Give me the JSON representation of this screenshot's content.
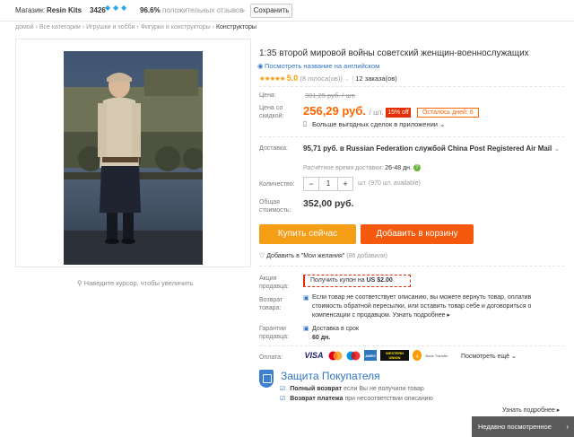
{
  "storebar": {
    "label": "Магазин:",
    "store_name": "Resin Kits",
    "score": "3426",
    "gems": [
      "💎",
      "💎",
      "💎"
    ],
    "positive_pct": "96.6%",
    "positive_label": "положительных отзывов",
    "save_label": "Сохранить"
  },
  "breadcrumb": [
    "домой",
    "Все категории",
    "Игрушки и хобби",
    "Фигурки и конструкторы",
    "Конструкторы"
  ],
  "image": {
    "zoom_hint": "Наведите курсор, чтобы увеличить"
  },
  "product": {
    "title": "1:35 второй мировой войны советский женщин-военнослужащих",
    "translate_link": "Посмотреть название на английском",
    "rating_value": "5.0",
    "votes": "(8 голоса(ов))",
    "orders": "12 заказа(ов)"
  },
  "price": {
    "label": "Цена:",
    "old": "301,25 руб. / шт.",
    "discount_label": "Цена со скидкой:",
    "new": "256,29 руб.",
    "unit": "/ шт.",
    "off_badge": "15% off",
    "days_left": "Осталось дней: 6",
    "app_deal": "Больше выгодных сделок в приложении"
  },
  "shipping": {
    "label": "Доставка:",
    "main": "95,71 руб. в Russian Federation службой China Post Registered Air Mail",
    "est_label": "Расчётное время доставки:",
    "est_value": "26-48 дн."
  },
  "quantity": {
    "label": "Количество:",
    "minus": "−",
    "value": "1",
    "plus": "+",
    "available": "шт. (970 шт. available)"
  },
  "total": {
    "label": "Общая стоимость:",
    "value": "352,00 руб."
  },
  "buttons": {
    "buy": "Купить сейчас",
    "cart": "Добавить в корзину"
  },
  "wishlist": {
    "label": "Добавить в \"Мои желания\"",
    "count": "(86 добавили)"
  },
  "coupon": {
    "label": "Акция продавца:",
    "text": "Получить купон на",
    "amount": "US $2.00"
  },
  "returns": {
    "label": "Возврат товара:",
    "text": "Если товар не соответствует описанию, вы можете вернуть товар, оплатив стоимость обратной пересылки, или оставить товар себе и договориться о компенсации с продавцом.",
    "link": "Узнать подробнее"
  },
  "guarantee": {
    "label": "Гарантии продавца:",
    "text": "Доставка в срок",
    "days": "60 дн."
  },
  "payment": {
    "label": "Оплата:",
    "logos": [
      "VISA",
      "MC",
      "Maestro",
      "AMEX",
      "WESTERN UNION",
      "QIWI",
      "Bank Transfer"
    ],
    "more": "Посмотреть ещё"
  },
  "protection": {
    "title": "Защита Покупателя",
    "line1_bold": "Полный возврат",
    "line1_text": "если Вы не получили товар",
    "line2_bold": "Возврат платежа",
    "line2_text": "при несоответствии описанию",
    "more": "Узнать подробнее"
  },
  "recent": {
    "label": "Недавно посмотренное"
  },
  "colors": {
    "orange_buy": "#f59d14",
    "orange_cart": "#f4590e",
    "price": "#ff6600",
    "link": "#3275c3"
  }
}
